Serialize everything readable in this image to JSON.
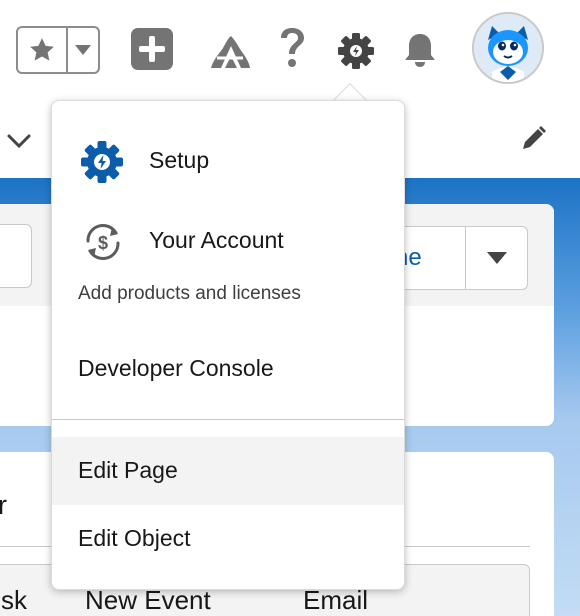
{
  "colors": {
    "icon_gray": "#747474",
    "setup_blue": "#0b5cab",
    "link_blue": "#0b5cab",
    "page_blue": "#1c73c4",
    "hover_bg": "#f3f3f3"
  },
  "header": {
    "icons": [
      "star-icon",
      "chevron-down-icon",
      "add-icon",
      "trailhead-icon",
      "help-icon",
      "gear-icon",
      "bell-icon",
      "avatar"
    ]
  },
  "record_card": {
    "button_partial": "ne"
  },
  "lower_card": {
    "title_partial": "r",
    "tabs": [
      "sk",
      "New Event",
      "Email"
    ]
  },
  "setup_menu": {
    "items": [
      {
        "label": "Setup",
        "icon": "setup-gear-icon"
      },
      {
        "label": "Your Account",
        "icon": "account-sync-icon",
        "sublabel": "Add products and licenses"
      },
      {
        "label": "Developer Console"
      },
      {
        "label": "Edit Page"
      },
      {
        "label": "Edit Object"
      }
    ]
  }
}
